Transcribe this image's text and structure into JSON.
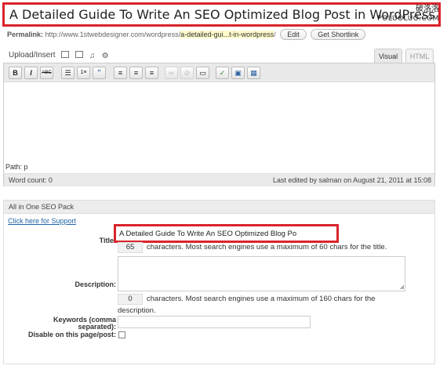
{
  "post": {
    "title": "A Detailed Guide To Write An SEO Optimized Blog Post in WordPress",
    "watermark_line1": "破洛洛",
    "watermark_line2": "POLUOLUO.COM"
  },
  "permalink": {
    "label": "Permalink:",
    "base": "http://www.1stwebdesigner.com/wordpress/",
    "slug": "a-detailed-gui...t-in-wordpress",
    "trailing": "/",
    "edit_button": "Edit",
    "shortlink_button": "Get Shortlink"
  },
  "media": {
    "upload_label": "Upload/Insert",
    "icons": [
      "image-icon",
      "video-icon",
      "audio-icon",
      "media-gear-icon"
    ]
  },
  "editor": {
    "tabs": [
      {
        "label": "Visual",
        "active": true
      },
      {
        "label": "HTML",
        "active": false
      }
    ],
    "toolbar": [
      {
        "name": "bold-button",
        "glyph": "B"
      },
      {
        "name": "italic-button",
        "glyph": "I"
      },
      {
        "name": "strikethrough-button",
        "glyph": "ABC"
      },
      {
        "name": "bullet-list-button",
        "glyph": "☰"
      },
      {
        "name": "numbered-list-button",
        "glyph": "1≡"
      },
      {
        "name": "blockquote-button",
        "glyph": "“"
      },
      {
        "name": "align-left-button",
        "glyph": "≡"
      },
      {
        "name": "align-center-button",
        "glyph": "≡"
      },
      {
        "name": "align-right-button",
        "glyph": "≡"
      },
      {
        "name": "insert-link-button",
        "glyph": "∞"
      },
      {
        "name": "unlink-button",
        "glyph": "⊘"
      },
      {
        "name": "insert-more-button",
        "glyph": "▭"
      },
      {
        "name": "spellcheck-button",
        "glyph": "✓"
      },
      {
        "name": "fullscreen-button",
        "glyph": "▣"
      },
      {
        "name": "kitchen-sink-button",
        "glyph": "▦"
      }
    ],
    "path": "Path: p",
    "word_count": "Word count: 0",
    "last_edited": "Last edited by salman on August 21, 2011 at 15:08"
  },
  "seo_pack": {
    "header": "All in One SEO Pack",
    "help_link": "Click here for Support",
    "title_label": "Title:",
    "title_value": "A Detailed Guide To Write An SEO Optimized Blog Po",
    "title_count": "65",
    "title_count_note": "characters. Most search engines use a maximum of 60 chars for the title.",
    "description_label": "Description:",
    "description_value": "",
    "description_count": "0",
    "description_count_note_line1": "characters. Most search engines use a maximum of 160 chars for the",
    "description_count_note_line2": "description.",
    "keywords_label_line1": "Keywords (comma",
    "keywords_label_line2": "separated):",
    "keywords_value": "",
    "disable_label": "Disable on this page/post:",
    "disable_checked": false
  },
  "colors": {
    "highlight_border": "#d9242b",
    "link": "#2166a8",
    "slug_background": "#fffbcc"
  }
}
